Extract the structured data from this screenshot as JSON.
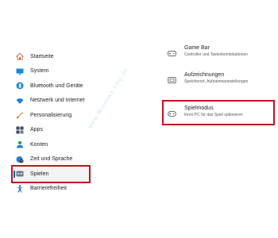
{
  "sidebar": {
    "items": [
      {
        "label": "Startseite",
        "icon": "home-icon"
      },
      {
        "label": "System",
        "icon": "monitor-icon"
      },
      {
        "label": "Bluetooth und Geräte",
        "icon": "bluetooth-icon"
      },
      {
        "label": "Netzwerk und Internet",
        "icon": "wifi-icon"
      },
      {
        "label": "Personalisierung",
        "icon": "brush-icon"
      },
      {
        "label": "Apps",
        "icon": "apps-icon"
      },
      {
        "label": "Konten",
        "icon": "person-icon"
      },
      {
        "label": "Zeit und Sprache",
        "icon": "globe-clock-icon"
      },
      {
        "label": "Spielen",
        "icon": "controller-icon",
        "active": true
      },
      {
        "label": "Barrierefreiheit",
        "icon": "accessibility-icon"
      }
    ]
  },
  "panel": {
    "items": [
      {
        "title": "Game Bar",
        "subtitle": "Controller und Tastenkombinationen",
        "icon": "gamebar-icon"
      },
      {
        "title": "Aufzeichnungen",
        "subtitle": "Speicherort, Aufnahmeeinstellungen",
        "icon": "capture-icon"
      },
      {
        "title": "Spielmodus",
        "subtitle": "Ihren PC für das Spiel optimieren",
        "icon": "gamemode-icon"
      }
    ]
  },
  "watermark": "www.Windows-FAQ.de"
}
